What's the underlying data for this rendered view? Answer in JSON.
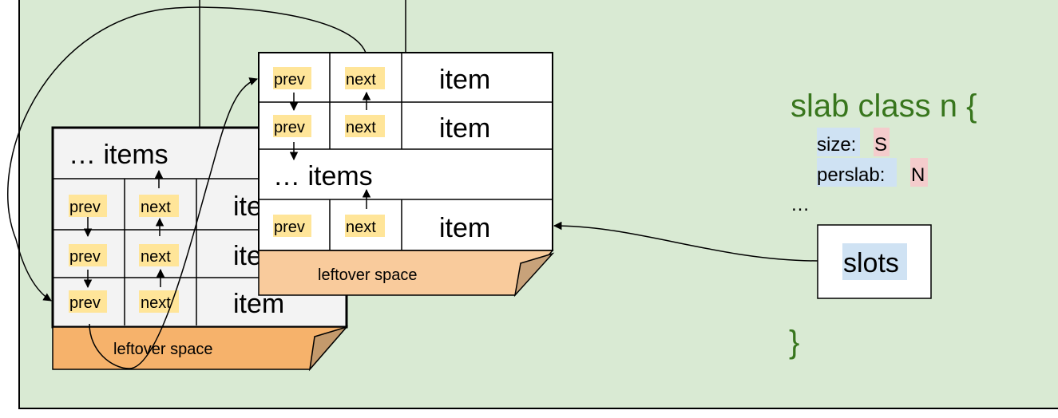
{
  "colors": {
    "background": "#d9ead3",
    "slab_back_fill": "#f3f3f3",
    "slab_front_fill": "#ffffff",
    "leftover_back": "#f6b26b",
    "leftover_front": "#f9cb9c",
    "field_highlight": "#ffe599",
    "key_highlight": "#cfe2f3",
    "value_highlight": "#f4cccc",
    "class_text": "#38761d"
  },
  "back_slab": {
    "items_row": "… items",
    "rows": [
      {
        "prev": "prev",
        "next": "next",
        "item": "item"
      },
      {
        "prev": "prev",
        "next": "next",
        "item": "item"
      },
      {
        "prev": "prev",
        "next": "next",
        "item": "item"
      }
    ],
    "leftover": "leftover space"
  },
  "front_slab": {
    "rows_top": [
      {
        "prev": "prev",
        "next": "next",
        "item": "item"
      },
      {
        "prev": "prev",
        "next": "next",
        "item": "item"
      }
    ],
    "items_row": "… items",
    "row_bottom": {
      "prev": "prev",
      "next": "next",
      "item": "item"
    },
    "leftover": "leftover space"
  },
  "slab_class": {
    "header": "slab class n {",
    "size_key": "size:",
    "size_value": "S",
    "perslab_key": "perslab:",
    "perslab_value": "N",
    "ellipsis": "…",
    "slots": "slots",
    "close": "}"
  }
}
